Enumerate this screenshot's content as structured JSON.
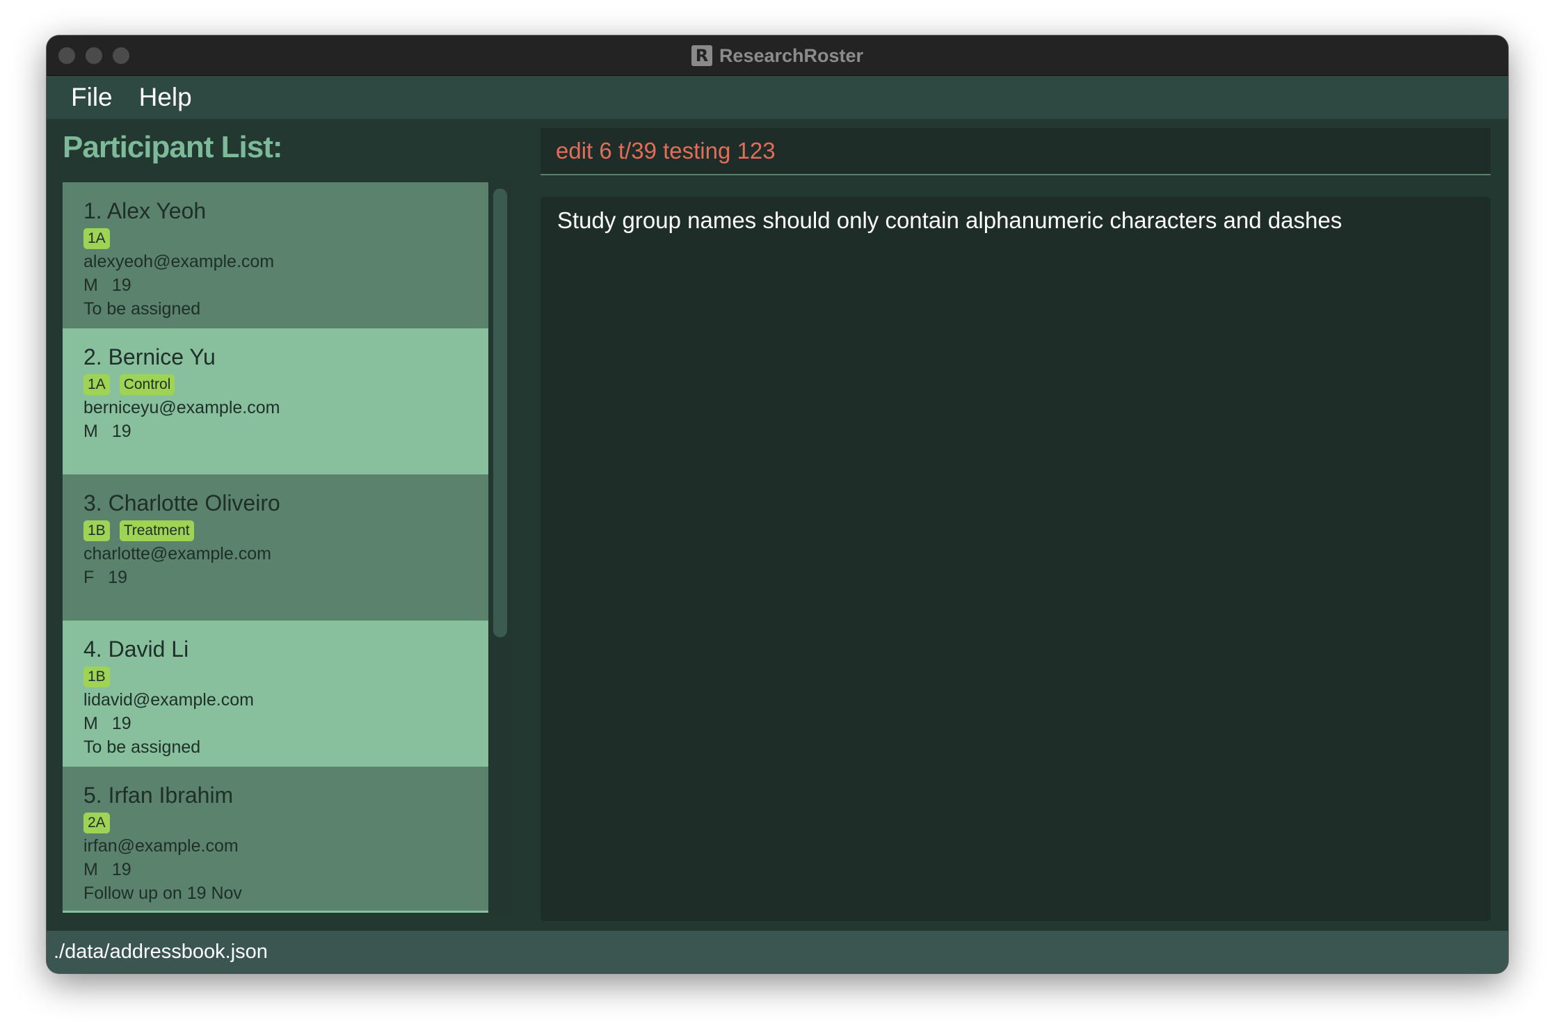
{
  "window": {
    "title": "ResearchRoster",
    "logo_glyph": "R"
  },
  "menubar": {
    "items": [
      "File",
      "Help"
    ]
  },
  "participant_list": {
    "heading": "Participant List:",
    "participants": [
      {
        "name": "1. Alex Yeoh",
        "tags": [
          "1A"
        ],
        "email": "alexyeoh@example.com",
        "gender": "M",
        "age": "19",
        "note": "To be assigned"
      },
      {
        "name": "2. Bernice Yu",
        "tags": [
          "1A",
          "Control"
        ],
        "email": "berniceyu@example.com",
        "gender": "M",
        "age": "19",
        "note": ""
      },
      {
        "name": "3. Charlotte Oliveiro",
        "tags": [
          "1B",
          "Treatment"
        ],
        "email": "charlotte@example.com",
        "gender": "F",
        "age": "19",
        "note": ""
      },
      {
        "name": "4. David Li",
        "tags": [
          "1B"
        ],
        "email": "lidavid@example.com",
        "gender": "M",
        "age": "19",
        "note": "To be assigned"
      },
      {
        "name": "5. Irfan Ibrahim",
        "tags": [
          "2A"
        ],
        "email": "irfan@example.com",
        "gender": "M",
        "age": "19",
        "note": "Follow up on 19 Nov"
      }
    ]
  },
  "command_box": {
    "value": "edit 6 t/39 testing 123"
  },
  "result_display": {
    "text": "Study group names should only contain alphanumeric characters and dashes"
  },
  "status_bar": {
    "path": "./data/addressbook.json"
  },
  "colors": {
    "window_bg": "#243832",
    "card_odd": "#5a826d",
    "card_even": "#88c09e",
    "tag": "#9ed355",
    "heading": "#7dba9a",
    "command_error": "#e26d5a"
  }
}
